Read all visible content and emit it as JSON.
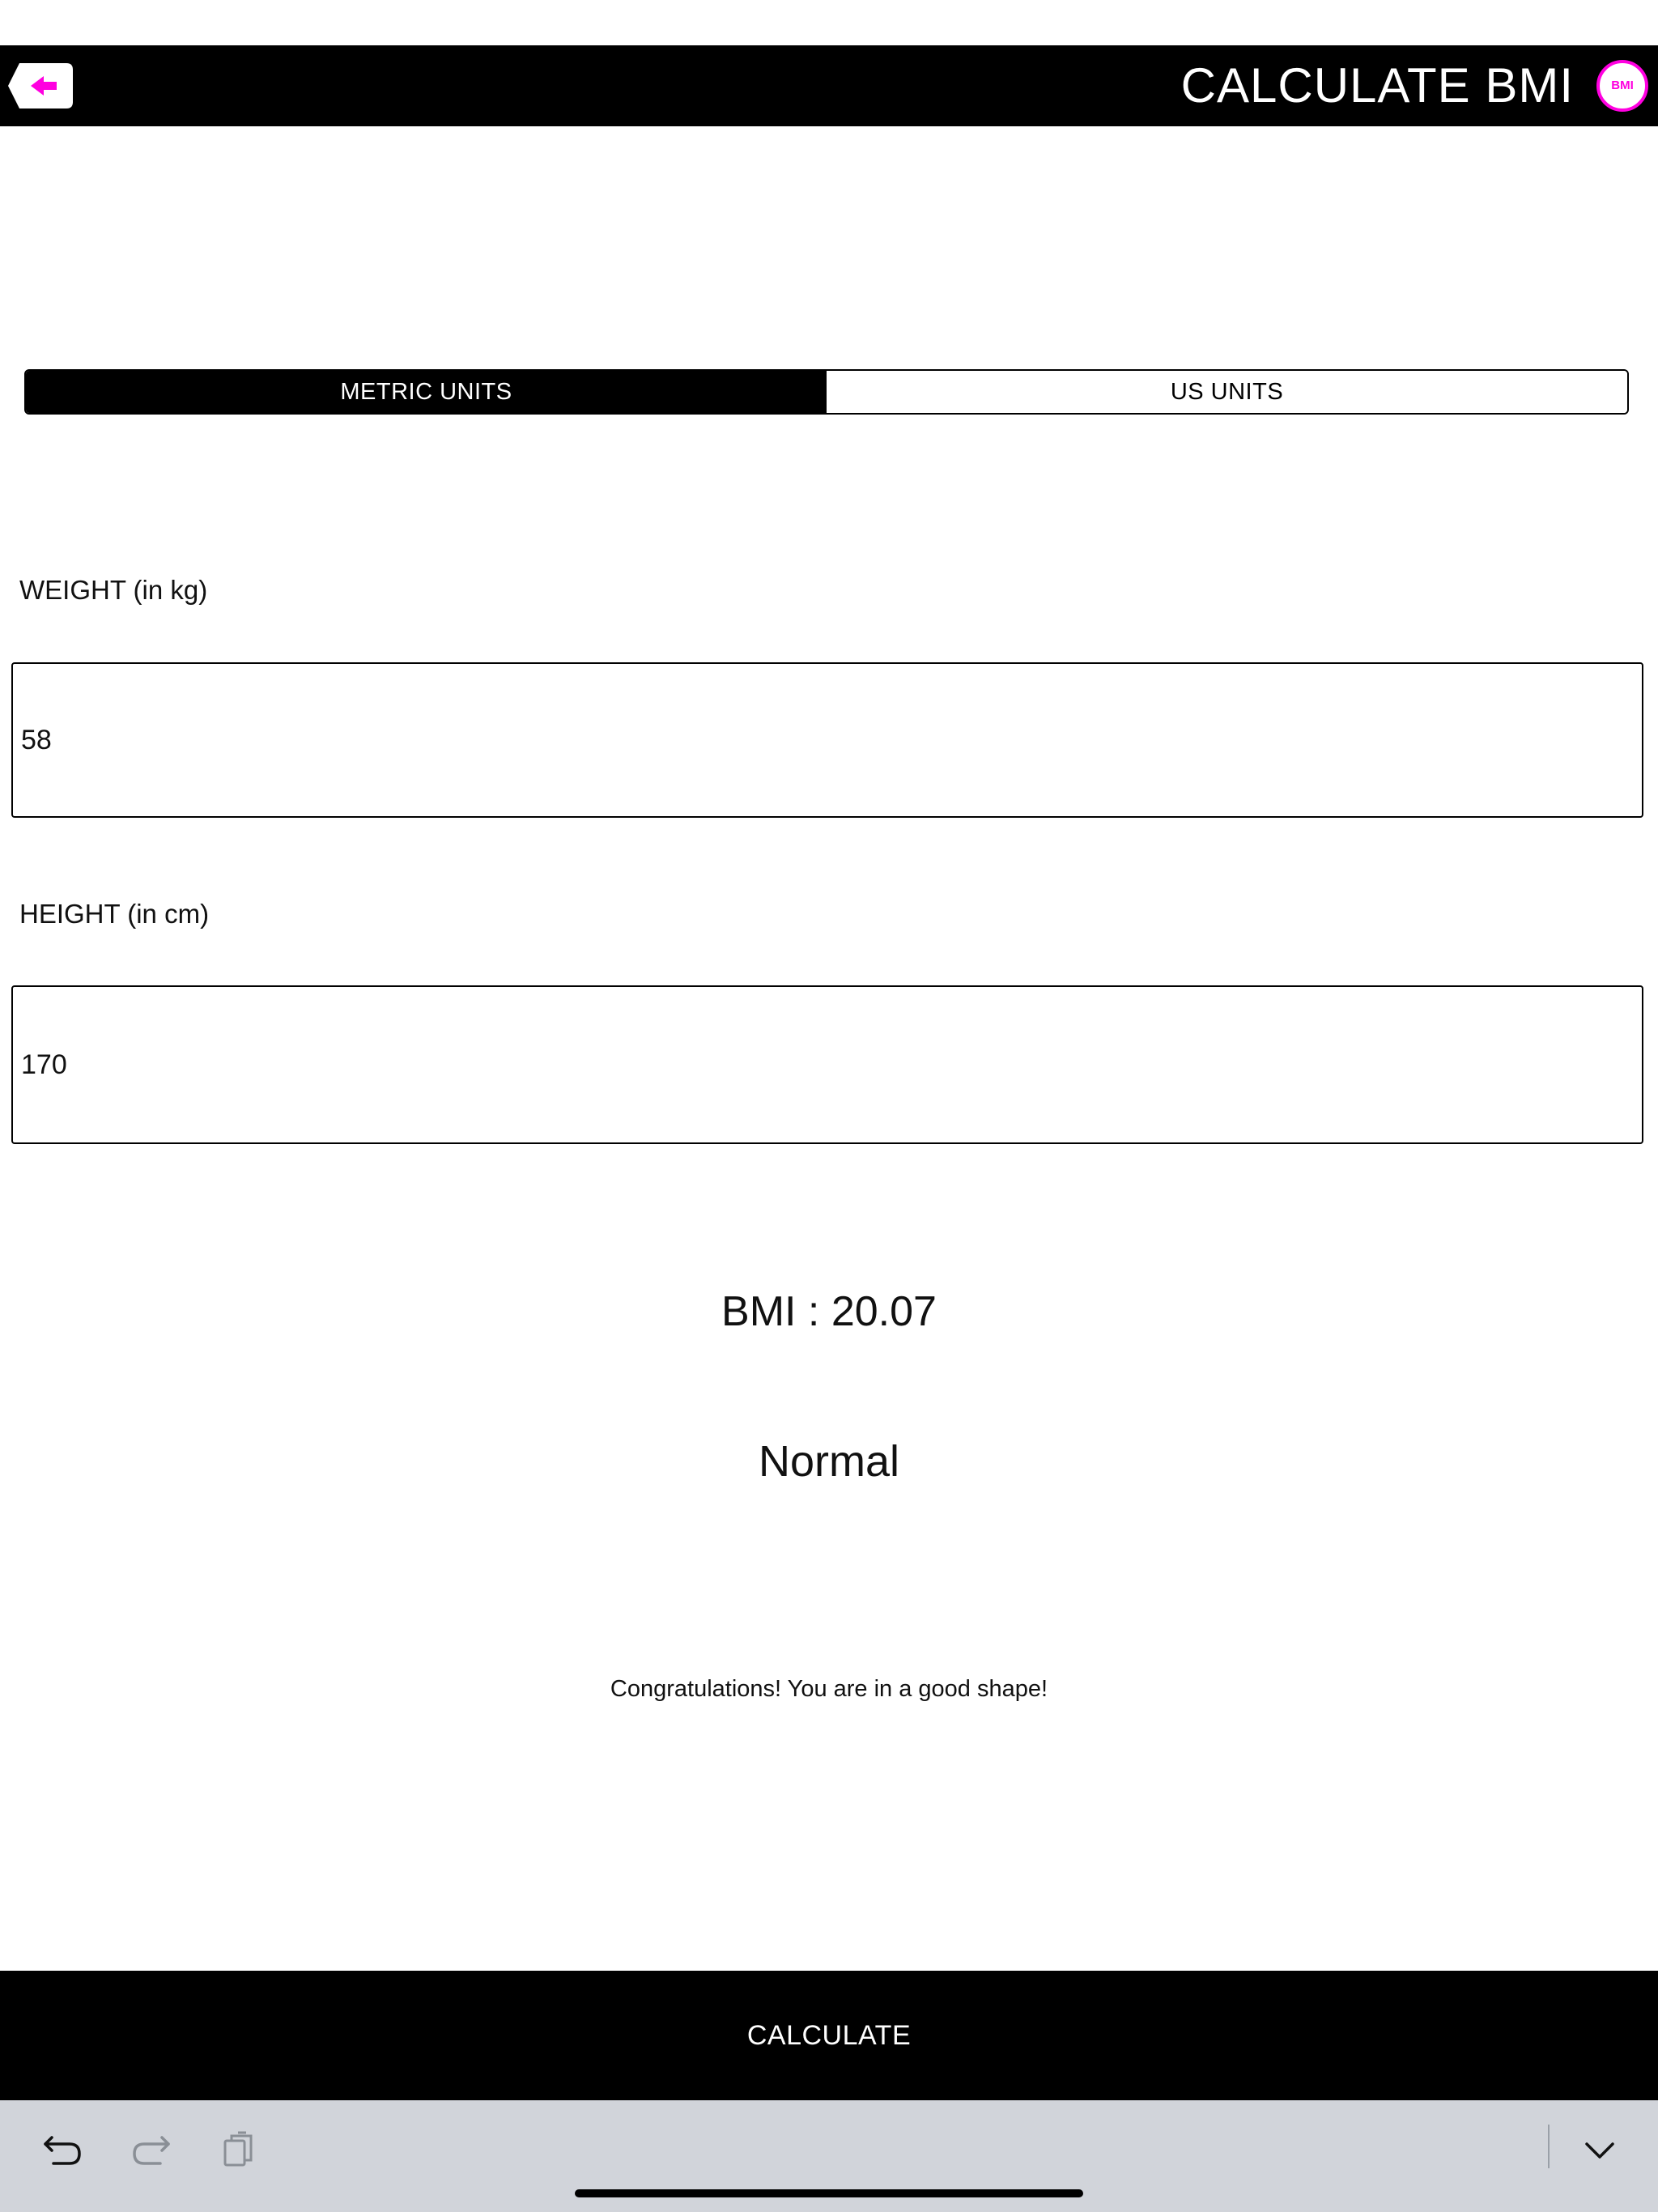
{
  "header": {
    "title": "CALCULATE BMI",
    "logo_text": "BMI"
  },
  "units_toggle": {
    "options": [
      {
        "label": "METRIC UNITS",
        "selected": true
      },
      {
        "label": "US UNITS",
        "selected": false
      }
    ]
  },
  "form": {
    "weight_label": "WEIGHT (in kg)",
    "weight_value": "58",
    "height_label": "HEIGHT (in cm)",
    "height_value": "170"
  },
  "result": {
    "bmi_text": "BMI : 20.07",
    "category": "Normal",
    "message": "Congratulations! You are in a good shape!"
  },
  "actions": {
    "calculate_label": "CALCULATE"
  },
  "keyboard_bar": {
    "icons": [
      "undo-icon",
      "redo-icon",
      "paste-icon",
      "chevron-down-icon"
    ]
  },
  "colors": {
    "accent": "#ff00e0",
    "bar_background": "#000000",
    "accessory_background": "#d1d4da"
  }
}
